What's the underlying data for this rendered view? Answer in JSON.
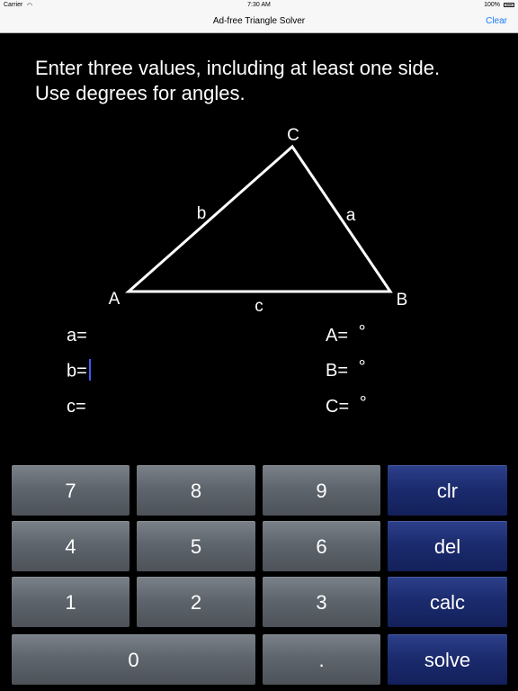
{
  "status": {
    "carrier": "Carrier",
    "time": "7:30 AM",
    "battery": "100%"
  },
  "nav": {
    "title": "Ad-free Triangle Solver",
    "clear": "Clear"
  },
  "instructions": {
    "line1": "Enter three values, including at least one side.",
    "line2": "Use degrees for angles."
  },
  "triangle": {
    "vertex_a": "A",
    "vertex_b": "B",
    "vertex_c": "C",
    "side_a": "a",
    "side_b": "b",
    "side_c": "c"
  },
  "fields": {
    "a": {
      "label": "a=",
      "value": ""
    },
    "b": {
      "label": "b=",
      "value": ""
    },
    "c": {
      "label": "c=",
      "value": ""
    },
    "A": {
      "label": "A=",
      "unit": "°"
    },
    "B": {
      "label": "B=",
      "unit": "°"
    },
    "C": {
      "label": "C=",
      "unit": "°"
    }
  },
  "keypad": {
    "k7": "7",
    "k8": "8",
    "k9": "9",
    "clr": "clr",
    "k4": "4",
    "k5": "5",
    "k6": "6",
    "del": "del",
    "k1": "1",
    "k2": "2",
    "k3": "3",
    "calc": "calc",
    "k0": "0",
    "dot": ".",
    "solve": "solve"
  },
  "colors": {
    "accent": "#1a7cf5",
    "caret": "#3b5bff",
    "op_key": "#1b2b6e",
    "num_key": "#5f656c"
  }
}
